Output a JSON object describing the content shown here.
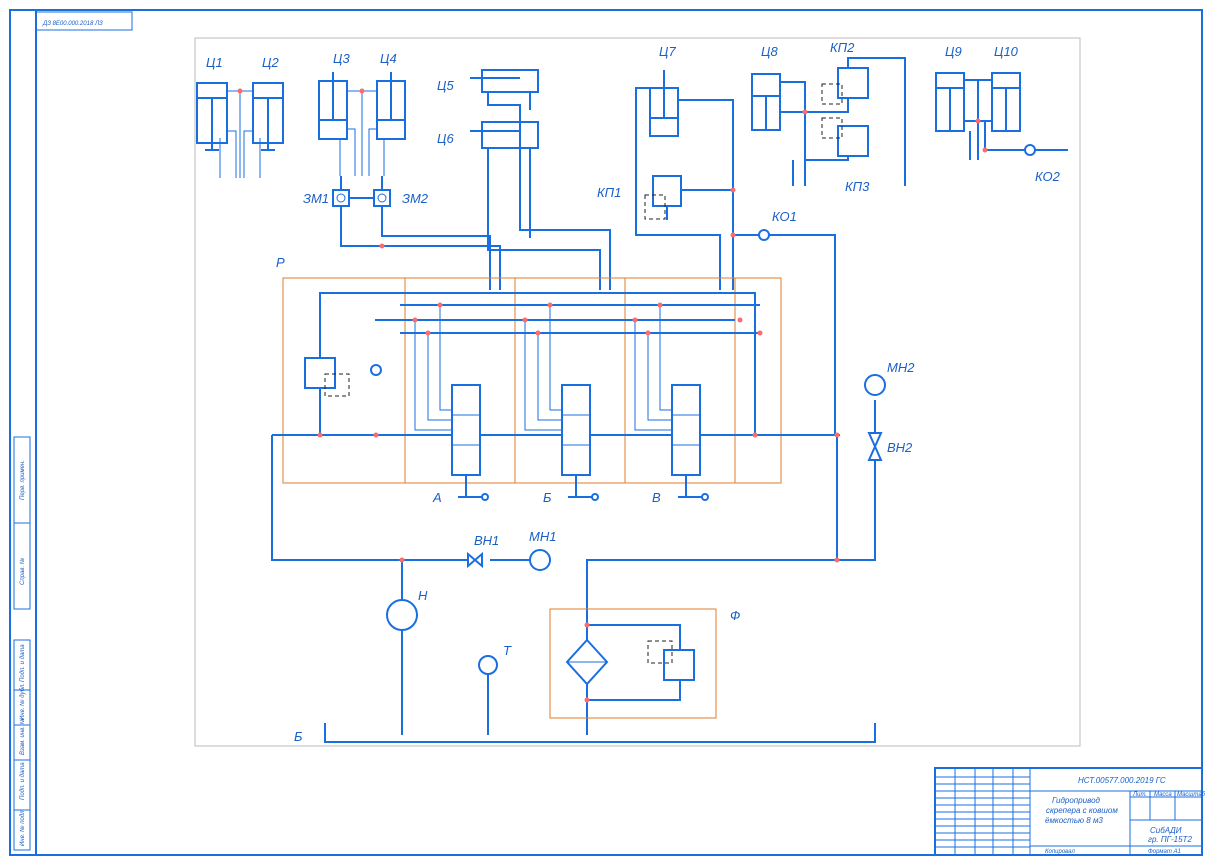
{
  "stamp_top": "ДЗ 8Е00.000.2018 ЛЗ",
  "labels": {
    "c1": "Ц1",
    "c2": "Ц2",
    "c3": "Ц3",
    "c4": "Ц4",
    "c5": "Ц5",
    "c6": "Ц6",
    "c7": "Ц7",
    "c8": "Ц8",
    "c9": "Ц9",
    "c10": "Ц10",
    "kp1": "КП1",
    "kp2": "КП2",
    "kp3": "КП3",
    "zm1": "ЗМ1",
    "zm2": "ЗМ2",
    "ko1": "КО1",
    "ko2": "КО2",
    "r": "Р",
    "mn1": "МН1",
    "mn2": "МН2",
    "vn1": "ВН1",
    "vn2": "ВН2",
    "a": "А",
    "b": "Б",
    "v": "В",
    "n": "Н",
    "t": "Т",
    "f": "Ф",
    "tank": "Б"
  },
  "title_block": {
    "doc_number": "НСТ.00577.000.2019 ГС",
    "title_line1": "Гидропривод",
    "title_line2": "скрепера с ковшом",
    "title_line3": "ёмкостью 8 м3",
    "org_line1": "СибАДИ",
    "org_line2": "гр. ПГ-15Т2",
    "copy": "Копировал",
    "format": "Формат А1",
    "col_lit": "Лит.",
    "col_mass": "Масса",
    "col_scale": "Масштаб"
  },
  "side_strip": {
    "s1": "Перв. примен.",
    "s2": "Справ. №",
    "s3": "Подп. и дата",
    "s4": "Инв. № дубл.",
    "s5": "Взам. инв. №",
    "s6": "Подп. и дата",
    "s7": "Инв. № подл."
  }
}
